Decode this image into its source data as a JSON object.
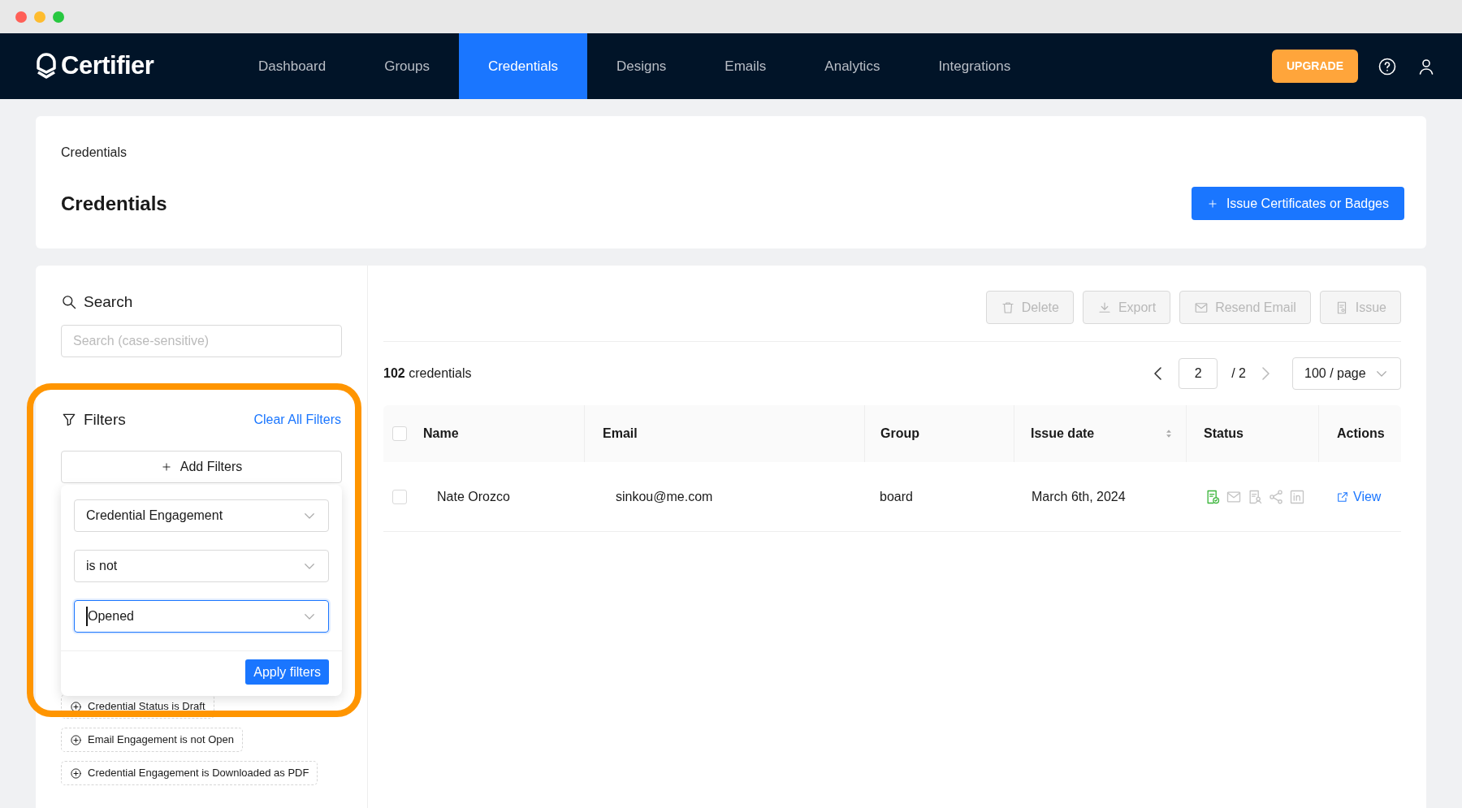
{
  "window": {
    "controls": [
      {
        "kind": "close"
      },
      {
        "kind": "minimize"
      },
      {
        "kind": "maximize"
      }
    ]
  },
  "nav": {
    "logo": "Certifier",
    "tabs": [
      {
        "label": "Dashboard",
        "selected": false
      },
      {
        "label": "Groups",
        "selected": false
      },
      {
        "label": "Credentials",
        "selected": true
      },
      {
        "label": "Designs",
        "selected": false
      },
      {
        "label": "Emails",
        "selected": false
      },
      {
        "label": "Analytics",
        "selected": false
      },
      {
        "label": "Integrations",
        "selected": false
      }
    ],
    "upgrade": "UPGRADE"
  },
  "header": {
    "breadcrumb": "Credentials",
    "title": "Credentials",
    "action": "Issue Certificates or Badges"
  },
  "sidebar": {
    "search_title": "Search",
    "search_placeholder": "Search (case-sensitive)",
    "filters_title": "Filters",
    "clear": "Clear All Filters",
    "add": "Add Filters",
    "popover": {
      "selects": [
        {
          "value": "Credential Engagement",
          "focused": false
        },
        {
          "value": "is not",
          "focused": false
        },
        {
          "value": "Opened",
          "focused": true
        }
      ],
      "apply": "Apply filters"
    },
    "tags": [
      "Credential Status is Draft",
      "Email Engagement is not Open",
      "Credential Engagement is Downloaded as PDF"
    ]
  },
  "toolbar": [
    {
      "kind": "delete",
      "label": "Delete",
      "disabled": true
    },
    {
      "kind": "export",
      "label": "Export",
      "disabled": true
    },
    {
      "kind": "email",
      "label": "Resend Email",
      "disabled": true
    },
    {
      "kind": "issue",
      "label": "Issue",
      "disabled": true
    }
  ],
  "summary": {
    "count": "102",
    "label": "credentials"
  },
  "pagination": {
    "page": "2",
    "total": "/ 2",
    "per_page": "100 / page"
  },
  "table": {
    "all_checked": false,
    "columns": [
      {
        "label": "Name",
        "sortable": false
      },
      {
        "label": "Email",
        "sortable": false
      },
      {
        "label": "Group",
        "sortable": false
      },
      {
        "label": "Issue date",
        "sortable": true
      },
      {
        "label": "Status",
        "sortable": false
      },
      {
        "label": "Actions",
        "sortable": false
      }
    ],
    "rows": [
      {
        "checked": false,
        "name": "Nate Orozco",
        "email": "sinkou@me.com",
        "group": "board",
        "issue_date": "March 6th, 2024",
        "status": [
          {
            "kind": "certificate",
            "active": true
          },
          {
            "kind": "email",
            "active": false
          },
          {
            "kind": "badge",
            "active": false
          },
          {
            "kind": "share",
            "active": false
          },
          {
            "kind": "linkedin",
            "active": false
          }
        ],
        "action": "View"
      }
    ]
  }
}
